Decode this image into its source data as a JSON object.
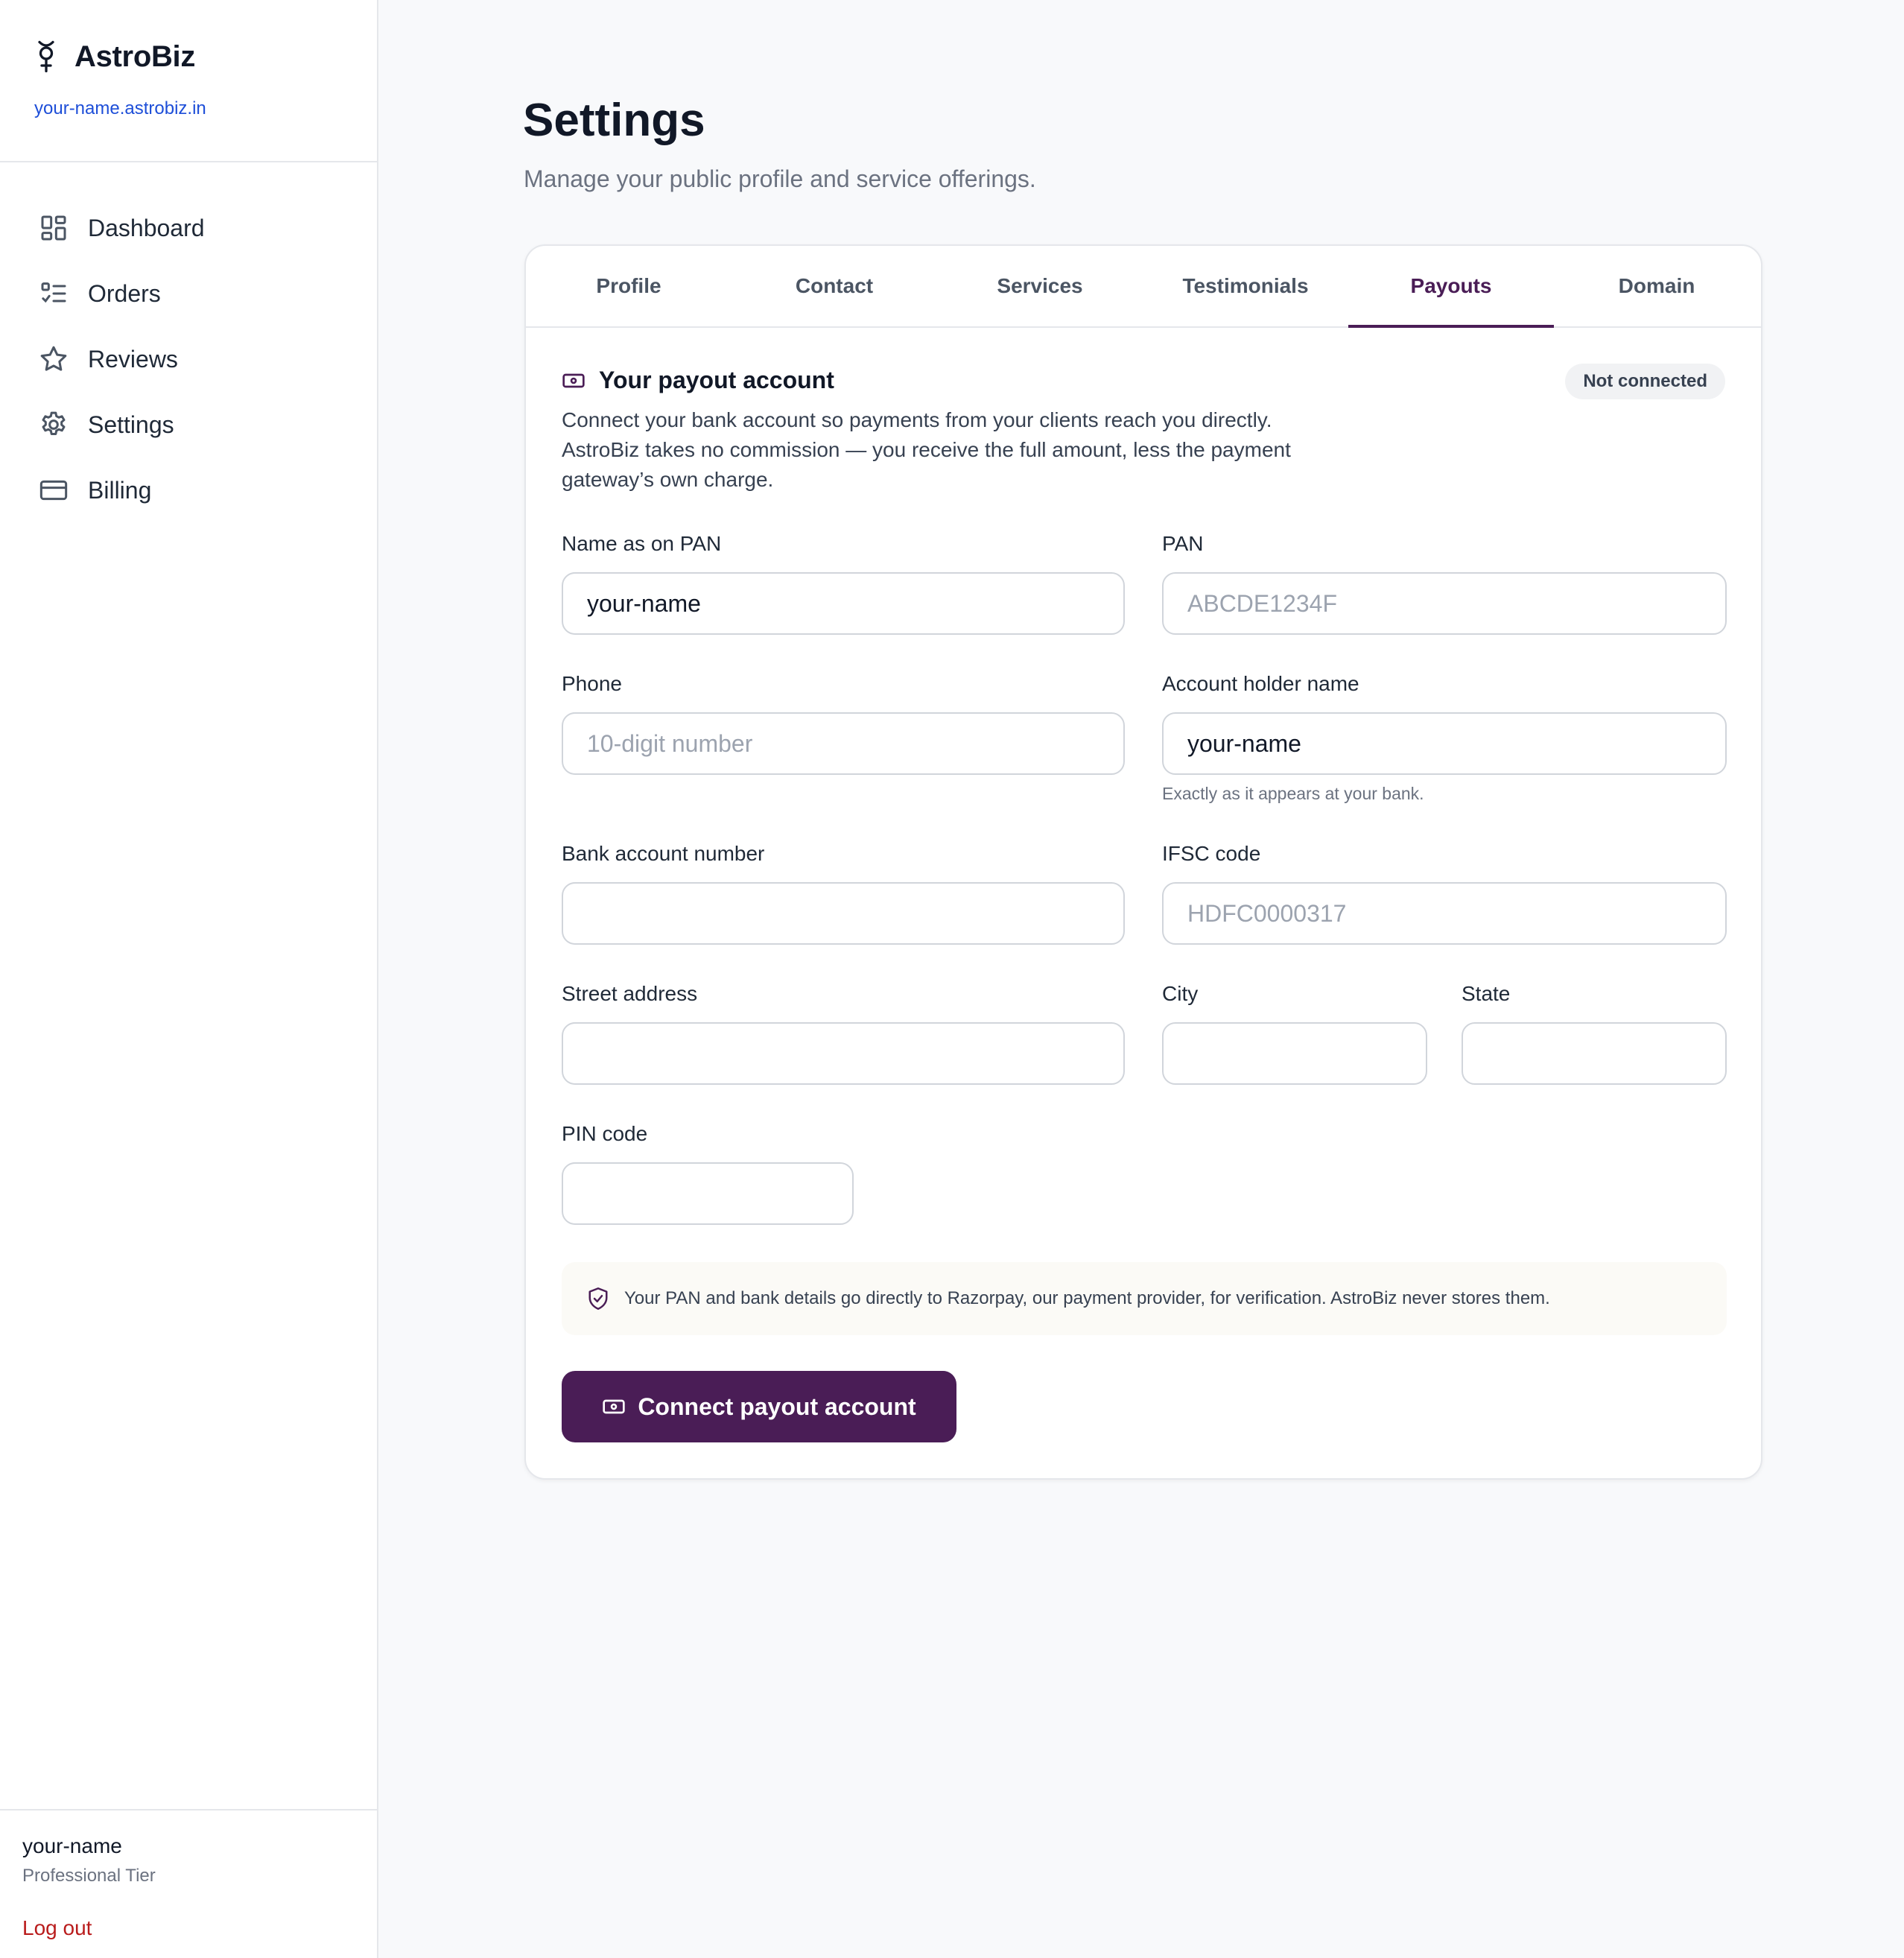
{
  "sidebar": {
    "brand_name": "AstroBiz",
    "brand_url": "your-name.astrobiz.in",
    "items": [
      {
        "label": "Dashboard",
        "icon": "dashboard-icon"
      },
      {
        "label": "Orders",
        "icon": "list-icon"
      },
      {
        "label": "Reviews",
        "icon": "star-icon"
      },
      {
        "label": "Settings",
        "icon": "gear-icon"
      },
      {
        "label": "Billing",
        "icon": "credit-card-icon"
      }
    ],
    "user_name": "your-name",
    "user_tier": "Professional Tier",
    "logout_label": "Log out"
  },
  "main": {
    "title": "Settings",
    "subtitle": "Manage your public profile and service offerings.",
    "tabs": [
      {
        "label": "Profile"
      },
      {
        "label": "Contact"
      },
      {
        "label": "Services"
      },
      {
        "label": "Testimonials"
      },
      {
        "label": "Payouts"
      },
      {
        "label": "Domain"
      }
    ],
    "active_tab": "Payouts"
  },
  "payout": {
    "title": "Your payout account",
    "status": "Not connected",
    "description": "Connect your bank account so payments from your clients reach you directly. AstroBiz takes no commission — you receive the full amount, less the payment gateway’s own charge.",
    "fields": {
      "name_on_pan": {
        "label": "Name as on PAN",
        "value": "your-name",
        "placeholder": ""
      },
      "pan": {
        "label": "PAN",
        "value": "",
        "placeholder": "ABCDE1234F"
      },
      "phone": {
        "label": "Phone",
        "value": "",
        "placeholder": "10-digit number"
      },
      "account_holder": {
        "label": "Account holder name",
        "value": "your-name",
        "placeholder": "",
        "hint": "Exactly as it appears at your bank."
      },
      "bank_account": {
        "label": "Bank account number",
        "value": "",
        "placeholder": ""
      },
      "ifsc": {
        "label": "IFSC code",
        "value": "",
        "placeholder": "HDFC0000317"
      },
      "street": {
        "label": "Street address",
        "value": "",
        "placeholder": ""
      },
      "city": {
        "label": "City",
        "value": "",
        "placeholder": ""
      },
      "state": {
        "label": "State",
        "value": "",
        "placeholder": ""
      },
      "pin": {
        "label": "PIN code",
        "value": "",
        "placeholder": ""
      }
    },
    "notice": "Your PAN and bank details go directly to Razorpay, our payment provider, for verification. AstroBiz never stores them.",
    "button_label": "Connect payout account"
  },
  "colors": {
    "accent": "#4a1d56",
    "link": "#1d4ed8",
    "danger": "#b91c1c",
    "background": "#f8f9fb"
  }
}
